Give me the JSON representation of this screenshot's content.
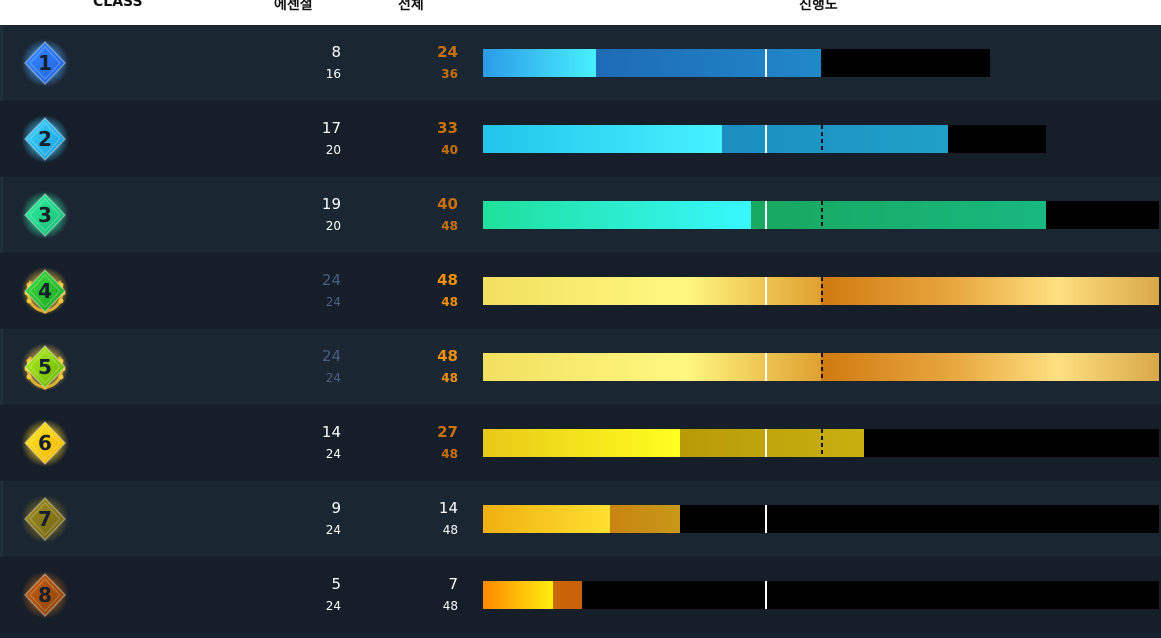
{
  "header": {
    "col_class": "CLASS",
    "col_excel": "에센셜",
    "col_total": "전체",
    "col_progress": "진행도"
  },
  "colors": {
    "page_bg": "#172330",
    "row_odd": "#1b2633",
    "row_even": "#151e29",
    "bar_empty": "#000000",
    "muted_number": "#4a6080",
    "orange_number": "#c8700a",
    "bright_orange_number": "#f0900a",
    "white_number": "#ffffff"
  },
  "rows": [
    {
      "class": "1",
      "excel_done": "8",
      "excel_total": "16",
      "total_done": "24",
      "total_max": "36",
      "badge": {
        "icon": "diamond-blue-icon",
        "c1": "#3a8cff",
        "c2": "#1b5fe0",
        "glow": "#49a6ff",
        "wreath": false
      },
      "excel_color": "#ffffff",
      "total_color": "#c8700a",
      "progress": {
        "solid_frac": 0.167,
        "fill_frac": 0.5,
        "bar_frac": 0.75
      },
      "gradA": [
        "#2b9be8",
        "#48f0ff"
      ],
      "gradB": [
        "#1e6bb8",
        "#2088c8"
      ]
    },
    {
      "class": "2",
      "excel_done": "17",
      "excel_total": "20",
      "total_done": "33",
      "total_max": "40",
      "badge": {
        "icon": "diamond-cyan-icon",
        "c1": "#3fd7ff",
        "c2": "#1898d8",
        "glow": "#46c9ff",
        "wreath": false
      },
      "excel_color": "#ffffff",
      "total_color": "#c8700a",
      "progress": {
        "solid_frac": 0.354,
        "fill_frac": 0.688,
        "bar_frac": 0.833
      },
      "gradA": [
        "#22c4ea",
        "#46f2ff"
      ],
      "gradB": [
        "#1a8ec0",
        "#20a0c8"
      ]
    },
    {
      "class": "3",
      "excel_done": "19",
      "excel_total": "20",
      "total_done": "40",
      "total_max": "48",
      "badge": {
        "icon": "diamond-green-icon",
        "c1": "#2ff2a0",
        "c2": "#14b870",
        "glow": "#2fe8a0",
        "wreath": false
      },
      "excel_color": "#ffffff",
      "total_color": "#c8700a",
      "progress": {
        "solid_frac": 0.396,
        "fill_frac": 0.833,
        "bar_frac": 1.0
      },
      "gradA": [
        "#1ee09a",
        "#38f8ff"
      ],
      "gradB": [
        "#18a860",
        "#18b880"
      ]
    },
    {
      "class": "4",
      "excel_done": "24",
      "excel_total": "24",
      "total_done": "48",
      "total_max": "48",
      "badge": {
        "icon": "diamond-green-wreath-icon",
        "c1": "#40e040",
        "c2": "#18a020",
        "glow": "#ffcf40",
        "wreath": true
      },
      "excel_color": "#4a6080",
      "total_color": "#f0900a",
      "progress": {
        "solid_frac": 0.5,
        "fill_frac": 1.0,
        "bar_frac": 1.0
      },
      "gradA": [
        "#f2e060",
        "#fff888"
      ],
      "gradB": [
        "#d07a10",
        "#e0a840"
      ]
    },
    {
      "class": "5",
      "excel_done": "24",
      "excel_total": "24",
      "total_done": "48",
      "total_max": "48",
      "badge": {
        "icon": "diamond-lime-wreath-icon",
        "c1": "#b8f020",
        "c2": "#60b000",
        "glow": "#ffcf40",
        "wreath": true
      },
      "excel_color": "#4a6080",
      "total_color": "#f0900a",
      "progress": {
        "solid_frac": 0.5,
        "fill_frac": 1.0,
        "bar_frac": 1.0
      },
      "gradA": [
        "#f2e060",
        "#fff888"
      ],
      "gradB": [
        "#d07a10",
        "#e0a840"
      ]
    },
    {
      "class": "6",
      "excel_done": "14",
      "excel_total": "24",
      "total_done": "27",
      "total_max": "48",
      "badge": {
        "icon": "diamond-yellow-icon",
        "c1": "#ffe820",
        "c2": "#f0b000",
        "glow": "#ffd22a",
        "wreath": false
      },
      "excel_color": "#ffffff",
      "total_color": "#c8700a",
      "progress": {
        "solid_frac": 0.292,
        "fill_frac": 0.563,
        "bar_frac": 1.0
      },
      "gradA": [
        "#e8c818",
        "#ffff20"
      ],
      "gradB": [
        "#b89a08",
        "#c8b010"
      ]
    },
    {
      "class": "7",
      "excel_done": "9",
      "excel_total": "24",
      "total_done": "14",
      "total_max": "48",
      "badge": {
        "icon": "diamond-olive-icon",
        "c1": "#a09020",
        "c2": "#706010",
        "glow": "#8a7a20",
        "wreath": false
      },
      "excel_color": "#ffffff",
      "total_color": "#ffffff",
      "progress": {
        "solid_frac": 0.188,
        "fill_frac": 0.292,
        "bar_frac": 1.0
      },
      "gradA": [
        "#f0b010",
        "#ffe030"
      ],
      "gradB": [
        "#c88410",
        "#c89818"
      ]
    },
    {
      "class": "8",
      "excel_done": "5",
      "excel_total": "24",
      "total_done": "7",
      "total_max": "48",
      "badge": {
        "icon": "diamond-bronze-icon",
        "c1": "#c86010",
        "c2": "#884008",
        "glow": "#b06018",
        "wreath": false
      },
      "excel_color": "#ffffff",
      "total_color": "#ffffff",
      "progress": {
        "solid_frac": 0.104,
        "fill_frac": 0.146,
        "bar_frac": 1.0
      },
      "gradA": [
        "#ff8800",
        "#ffee10"
      ],
      "gradB": [
        "#cc6608",
        "#c86008"
      ]
    }
  ]
}
